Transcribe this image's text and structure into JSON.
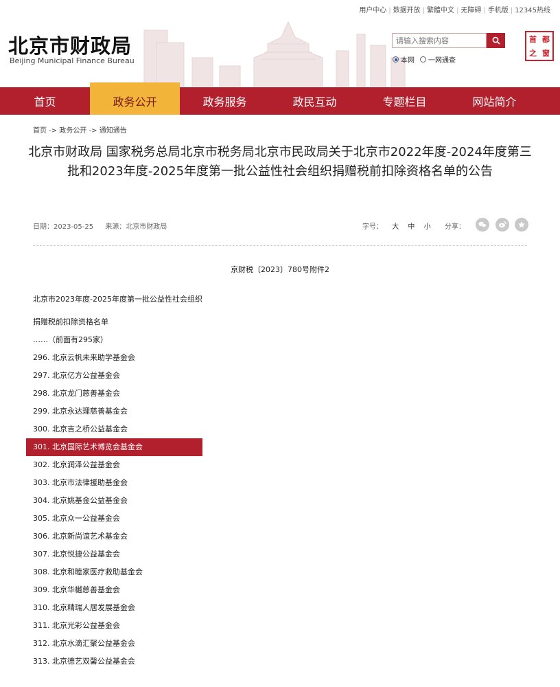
{
  "top_links": [
    "用户中心",
    "数据开放",
    "繁體中文",
    "无障碍",
    "手机版",
    "12345热线"
  ],
  "site": {
    "title": "北京市财政局",
    "subtitle": "Beijing Municipal Finance Bureau"
  },
  "search": {
    "placeholder": "请输入搜索内容",
    "scope_options": [
      "本网",
      "一网通查"
    ],
    "selected_scope": "本网"
  },
  "seal": [
    "首",
    "都",
    "之",
    "窗"
  ],
  "nav": {
    "items": [
      "首页",
      "政务公开",
      "政务服务",
      "政民互动",
      "专题栏目",
      "网站简介"
    ],
    "active": "政务公开"
  },
  "breadcrumb": [
    "首页",
    "政务公开",
    "通知通告"
  ],
  "breadcrumb_sep": "->",
  "article": {
    "title": "北京市财政局 国家税务总局北京市税务局北京市民政局关于北京市2022年度-2024年度第三批和2023年度-2025年度第一批公益性社会组织捐赠税前扣除资格名单的公告",
    "date_label": "日期：",
    "date": "2023-05-25",
    "source_label": "来源：",
    "source": "北京市财政局",
    "font_label": "字号：",
    "font_sizes": [
      "大",
      "中",
      "小"
    ],
    "share_label": "分享：",
    "share_icons": [
      "wechat-icon",
      "weibo-icon",
      "favorite-icon"
    ],
    "doc_ref": "京财税〔2023〕780号附件2",
    "intro_lines": [
      "北京市2023年度-2025年度第一批公益性社会组织",
      "捐赠税前扣除资格名单",
      "……（前面有295家）"
    ],
    "items": [
      "296. 北京云帆未来助学基金会",
      "297. 北京亿方公益基金会",
      "298. 北京龙门慈善基金会",
      "299. 北京永达理慈善基金会",
      "300. 北京吉之桥公益基金会",
      "301. 北京国际艺术博览会基金会",
      "302. 北京润泽公益基金会",
      "303. 北京市法律援助基金会",
      "304. 北京姚基金公益基金会",
      "305. 北京众一公益基金会",
      "306. 北京新尚谊艺术基金会",
      "307. 北京悦捷公益基金会",
      "308. 北京和睦家医疗救助基金会",
      "309. 北京华樾慈善基金会",
      "310. 北京精瑞人居发展基金会",
      "311. 北京光彩公益基金会",
      "312. 北京水滴汇聚公益基金会",
      "313. 北京德艺双馨公益基金会"
    ],
    "highlighted_item": "301. 北京国际艺术博览会基金会"
  },
  "colors": {
    "brand_red": "#b21f2d",
    "nav_active": "#f3b43a"
  }
}
